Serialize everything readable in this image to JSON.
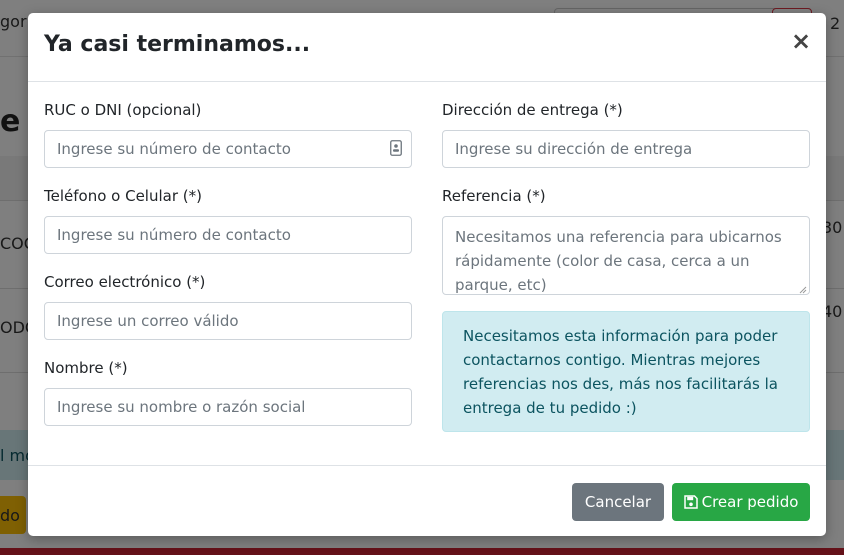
{
  "background": {
    "frag_top_left": "gor",
    "frag_top_right": "2",
    "frag_heading": "e d",
    "frag_row1_left": "COC",
    "frag_row1_right": "30",
    "frag_row2_left": "ODC",
    "frag_row2_right": "40",
    "frag_alert": "l mo",
    "frag_button": "do"
  },
  "modal": {
    "title": "Ya casi terminamos...",
    "close_label": "×",
    "fields": {
      "ruc": {
        "label": "RUC o DNI (opcional)",
        "placeholder": "Ingrese su número de contacto"
      },
      "telefono": {
        "label": "Teléfono o Celular (*)",
        "placeholder": "Ingrese su número de contacto"
      },
      "correo": {
        "label": "Correo electrónico (*)",
        "placeholder": "Ingrese un correo válido"
      },
      "nombre": {
        "label": "Nombre (*)",
        "placeholder": "Ingrese su nombre o razón social"
      },
      "direccion": {
        "label": "Dirección de entrega (*)",
        "placeholder": "Ingrese su dirección de entrega"
      },
      "referencia": {
        "label": "Referencia (*)",
        "placeholder": "Necesitamos una referencia para ubicarnos rápidamente (color de casa, cerca a un parque, etc)"
      }
    },
    "info_text": "Necesitamos esta información para poder contactarnos contigo. Mientras mejores referencias nos des, más nos facilitarás la entrega de tu pedido :)",
    "footer": {
      "cancel_label": "Cancelar",
      "create_label": "Crear pedido"
    }
  },
  "colors": {
    "info_bg": "#d1ecf1",
    "info_text": "#0c5460",
    "cancel": "#6c757d",
    "create": "#28a745"
  },
  "icons": {
    "close": "close-icon",
    "contact": "contact-card-icon",
    "save": "save-icon"
  }
}
